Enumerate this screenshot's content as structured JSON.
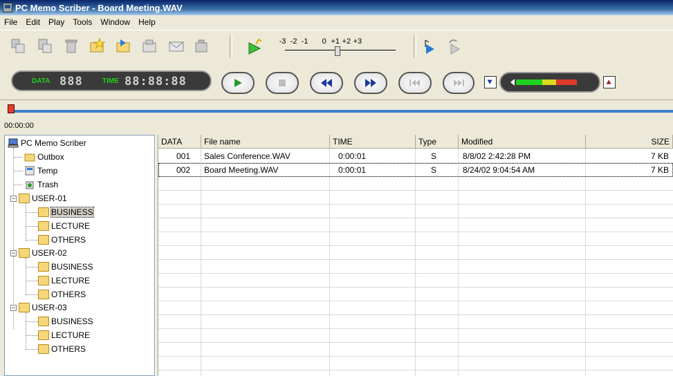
{
  "window": {
    "title": "PC Memo Scriber - Board Meeting.WAV"
  },
  "menu": [
    "File",
    "Edit",
    "Play",
    "Tools",
    "Window",
    "Help"
  ],
  "speed": {
    "labels": [
      "-3",
      "-2",
      "-1",
      "0",
      "+1",
      "+2",
      "+3"
    ]
  },
  "counter": {
    "data_label": "DATA",
    "data_value": "888",
    "time_label": "TIME",
    "time_value": "88:88:88"
  },
  "timeline": {
    "position": "00:00:00"
  },
  "tree": {
    "root": "PC Memo Scriber",
    "items": [
      {
        "label": "Outbox"
      },
      {
        "label": "Temp"
      },
      {
        "label": "Trash"
      },
      {
        "label": "USER-01",
        "children": [
          "BUSINESS",
          "LECTURE",
          "OTHERS"
        ]
      },
      {
        "label": "USER-02",
        "children": [
          "BUSINESS",
          "LECTURE",
          "OTHERS"
        ]
      },
      {
        "label": "USER-03",
        "children": [
          "BUSINESS",
          "LECTURE",
          "OTHERS"
        ]
      }
    ],
    "selected": "USER-01/BUSINESS"
  },
  "table": {
    "columns": [
      "DATA",
      "File name",
      "TIME",
      "Type",
      "Modified",
      "SIZE"
    ],
    "rows": [
      [
        "001",
        "Sales Conference.WAV",
        "0:00:01",
        "S",
        "8/8/02 2:42:28 PM",
        "7 KB"
      ],
      [
        "002",
        "Board Meeting.WAV",
        "0:00:01",
        "S",
        "8/24/02 9:04:54 AM",
        "7 KB"
      ]
    ]
  },
  "colors": {
    "accent": "#3a7fd0",
    "counter_green": "#1fd11f",
    "title_blue": "#0a246a"
  }
}
